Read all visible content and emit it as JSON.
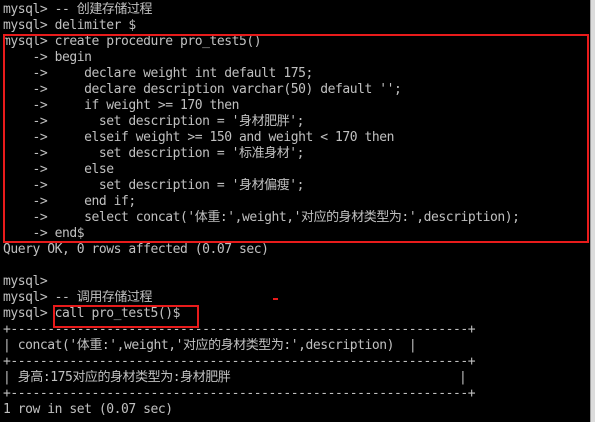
{
  "console": {
    "lines": [
      "mysql> -- 创建存储过程",
      "mysql> delimiter $",
      "mysql> create procedure pro_test5()",
      "    -> begin",
      "    ->     declare weight int default 175;",
      "    ->     declare description varchar(50) default '';",
      "    ->     if weight >= 170 then",
      "    ->       set description = '身材肥胖';",
      "    ->     elseif weight >= 150 and weight < 170 then",
      "    ->       set description = '标准身材';",
      "    ->     else",
      "    ->       set description = '身材偏瘦';",
      "    ->     end if;",
      "    ->     select concat('体重:',weight,'对应的身材类型为:',description);",
      "    -> end$",
      "Query OK, 0 rows affected (0.07 sec)",
      "",
      "mysql>",
      "mysql> -- 调用存储过程",
      "mysql> call pro_test5()$",
      "+--------------------------------------------------------------+",
      "| concat('体重:',weight,'对应的身材类型为:',description)  |",
      "+--------------------------------------------------------------+",
      "| 身高:175对应的身材类型为:身材肥胖                               |",
      "+--------------------------------------------------------------+",
      "1 row in set (0.07 sec)"
    ]
  }
}
